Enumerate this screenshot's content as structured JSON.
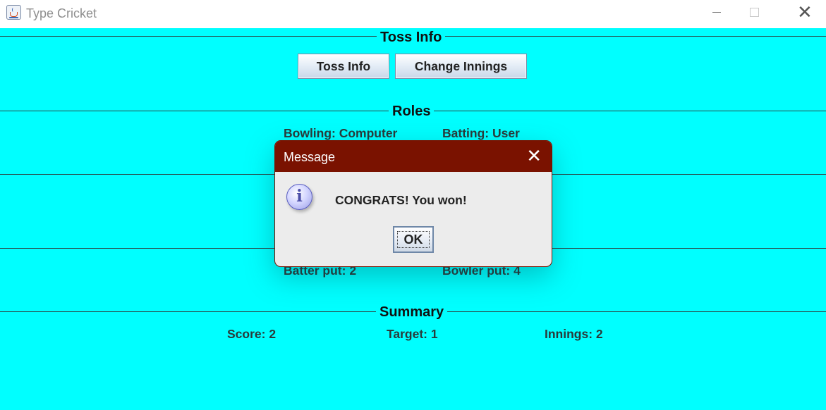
{
  "window": {
    "title": "Type Cricket",
    "icon": "java-cup-icon",
    "controls": [
      "minimize-icon",
      "maximize-icon",
      "close-icon"
    ]
  },
  "colors": {
    "background": "#00ffff",
    "dialog_title": "#7a1200",
    "dialog_body": "#ececec"
  },
  "toss_section": {
    "title": "Toss Info",
    "buttons": {
      "toss_info": "Toss Info",
      "change_innings": "Change Innings"
    }
  },
  "roles_section": {
    "title": "Roles",
    "bowling": "Bowling: Computer",
    "batting": "Batting: User"
  },
  "play_section": {
    "batter_put": "Batter put: 2",
    "bowler_put": "Bowler put: 4"
  },
  "summary_section": {
    "title": "Summary",
    "score": "Score: 2",
    "target": "Target: 1",
    "innings": "Innings: 2"
  },
  "dialog": {
    "title": "Message",
    "icon": "info-icon",
    "message": "CONGRATS! You won!",
    "ok_label": "OK"
  }
}
